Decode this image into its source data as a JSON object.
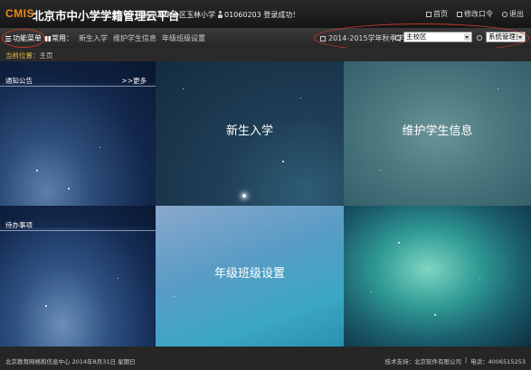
{
  "header": {
    "logo": "CMIS",
    "title": "北京市中小学学籍管理云平台",
    "school": "北京市丰台区玉林小学",
    "user_status": "01060203 登录成功！",
    "links": [
      {
        "label": "首页",
        "icon": "home-icon"
      },
      {
        "label": "修改口令",
        "icon": "key-icon"
      },
      {
        "label": "退出",
        "icon": "power-icon"
      }
    ]
  },
  "navbar": {
    "menu_label": "功能菜单",
    "quick_label": "常用：",
    "quick_links": [
      "新生入学",
      "维护学生信息",
      "年级班级设置"
    ],
    "term": "2014-2015学年秋季学期",
    "campus_select": "主校区",
    "role_select": "系统管理员"
  },
  "breadcrumb": {
    "label": "当前位置：",
    "value": "主页"
  },
  "panels": {
    "notice_title": "通知公告",
    "notice_more": ">>更多",
    "todo_title": "待办事项"
  },
  "tiles": {
    "new_student": "新生入学",
    "maintain_info": "维护学生信息",
    "class_setting": "年级班级设置"
  },
  "footer": {
    "left": "北京教育网络和信息中心 2014年8月31日 星期日",
    "support_label": "技术支持：",
    "support_company": "北京软件有限公司",
    "phone_label": "电话：",
    "phone": "4006515253"
  },
  "colors": {
    "logo": "#f08a17",
    "annotation_ellipse": "#c0392b",
    "breadcrumb_label": "#e5b94a"
  }
}
